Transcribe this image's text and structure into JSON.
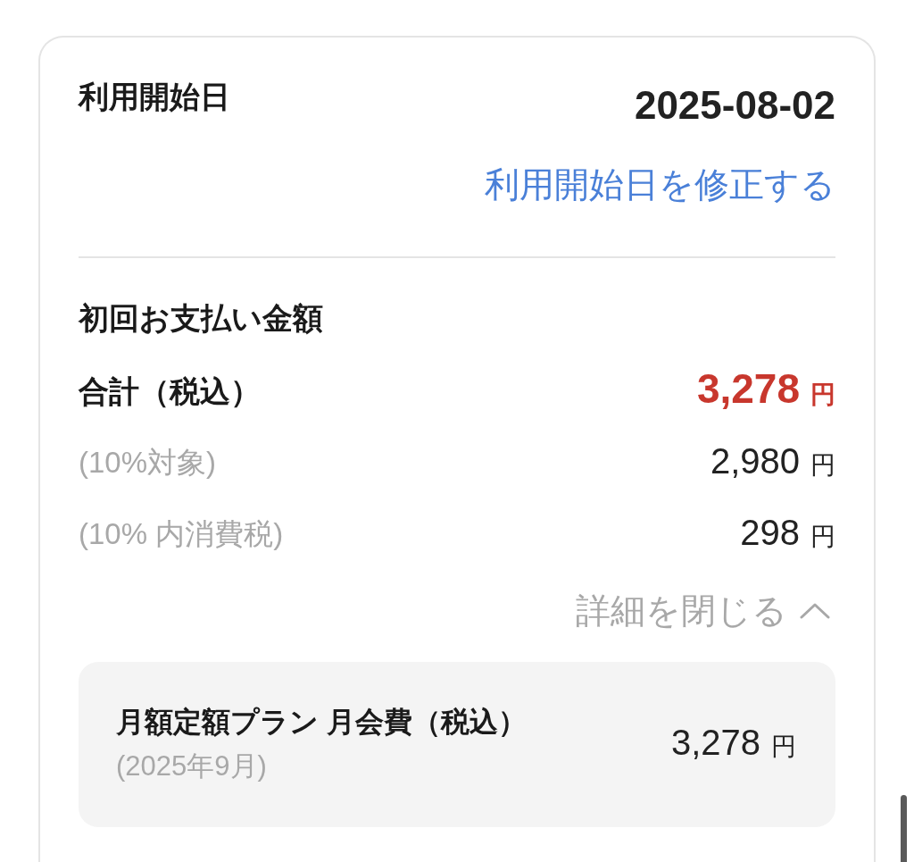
{
  "start_date": {
    "label": "利用開始日",
    "value": "2025-08-02",
    "edit_link": "利用開始日を修正する"
  },
  "initial_payment": {
    "title": "初回お支払い金額",
    "rows": [
      {
        "kind": "total",
        "label": "合計（税込）",
        "amount": "3,278",
        "unit": "円"
      },
      {
        "kind": "detail",
        "label": "(10%対象)",
        "amount": "2,980",
        "unit": "円"
      },
      {
        "kind": "detail",
        "label": "(10% 内消費税)",
        "amount": "298",
        "unit": "円"
      }
    ],
    "details_toggle": {
      "label": "詳細を閉じる",
      "expanded": true
    }
  },
  "plan_item": {
    "name": "月額定額プラン 月会費（税込）",
    "period": "(2025年9月)",
    "amount": "3,278",
    "unit": "円"
  }
}
